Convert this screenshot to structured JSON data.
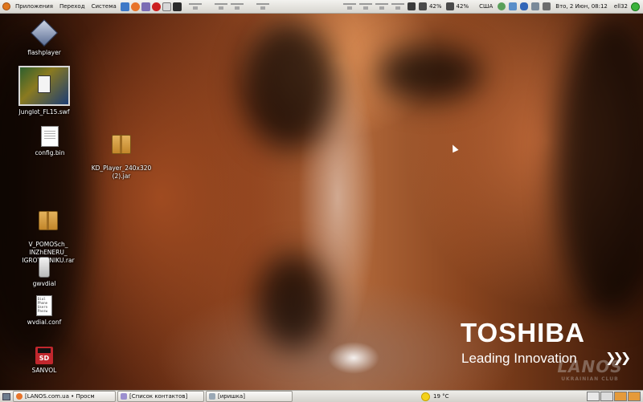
{
  "top_panel": {
    "menus": [
      "Приложения",
      "Переход",
      "Система"
    ],
    "launchers": [
      {
        "icon": "help-icon",
        "color": "#3e79c7"
      },
      {
        "icon": "firefox-icon",
        "color": "#e8742a"
      },
      {
        "icon": "pidgin-icon",
        "color": "#7b6db4"
      },
      {
        "icon": "opera-icon",
        "color": "#cc1f1f"
      },
      {
        "icon": "mail-icon",
        "color": "#d8d8d8"
      },
      {
        "icon": "terminal-icon",
        "color": "#2b2b2b"
      }
    ],
    "battery1": "42%",
    "battery2": "42%",
    "keyboard_layout": "США",
    "datetime": "Вто, 2 Июн, 08:12",
    "username": "ell32"
  },
  "desktop_icons": [
    {
      "label": "flashplayer",
      "icon": "flash-icon"
    },
    {
      "label": "Junglot_FL15.swf",
      "icon": "swf-thumbnail-icon"
    },
    {
      "label": "config.bin",
      "icon": "document-icon"
    },
    {
      "label": "KD_Player_240x320\n(2).jar",
      "icon": "archive-icon"
    },
    {
      "label": "V_POMOSch_\nINZhENERU_\nIGROTEHNIKU.rar",
      "icon": "archive-icon"
    },
    {
      "label": "gwvdial",
      "icon": "phone-icon"
    },
    {
      "label": "wvdial.conf",
      "icon": "config-file-icon",
      "preview": "Dial\nPhone\nUsern\nPassw"
    },
    {
      "label": "SANVOL",
      "icon": "sd-card-icon",
      "badge": "SD"
    }
  ],
  "branding": {
    "title": "TOSHIBA",
    "tagline": "Leading Innovation",
    "arrows": "❯❯❯",
    "watermark_main": "LANOS",
    "watermark_sub": "UKRAINIAN CLUB"
  },
  "bottom_panel": {
    "tasks": [
      {
        "label": "[LANOS.com.ua • Просм",
        "icon": "firefox-icon",
        "color": "#e8742a"
      },
      {
        "label": "[Список контактов]",
        "icon": "pidgin-icon",
        "color": "#9c8fcf"
      },
      {
        "label": "[иришка]",
        "icon": "chat-icon",
        "color": "#9aa8b5"
      }
    ],
    "weather": "19 °C"
  }
}
